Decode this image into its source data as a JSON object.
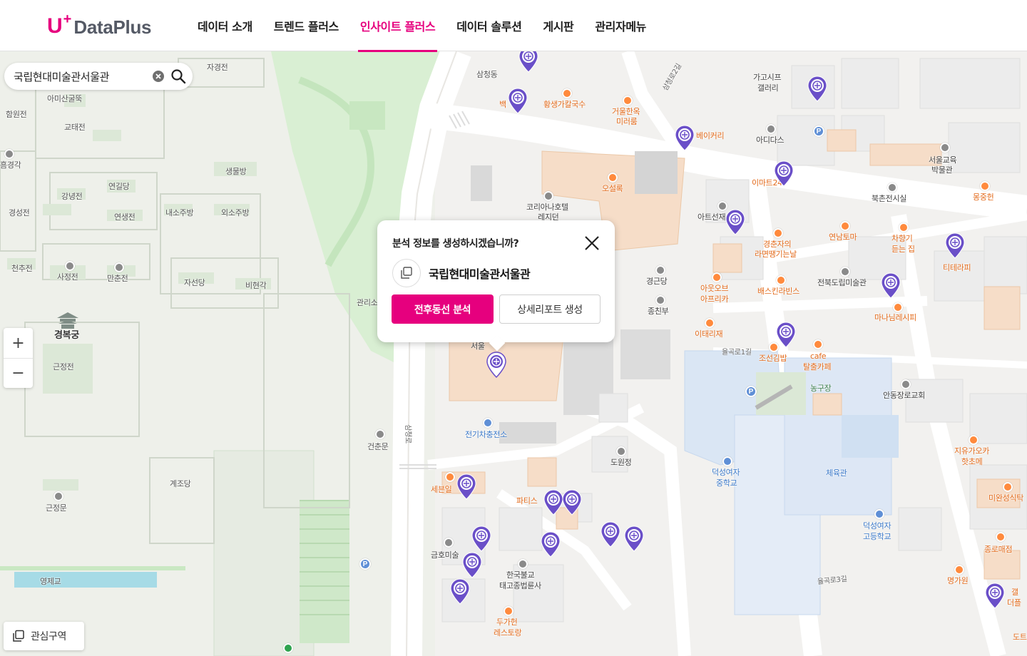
{
  "header": {
    "logo": {
      "mark": "U",
      "plus": "+",
      "text": "DataPlus"
    },
    "nav": [
      {
        "label": "데이터 소개",
        "active": false
      },
      {
        "label": "트렌드 플러스",
        "active": false
      },
      {
        "label": "인사이트 플러스",
        "active": true
      },
      {
        "label": "데이터 솔루션",
        "active": false
      },
      {
        "label": "게시판",
        "active": false
      },
      {
        "label": "관리자메뉴",
        "active": false
      }
    ]
  },
  "search": {
    "value": "국립현대미술관서울관",
    "clear_icon": "clear-icon",
    "search_icon": "search-icon"
  },
  "zoom": {
    "in": "+",
    "out": "−"
  },
  "interest_zone": {
    "label": "관심구역",
    "icon": "interest-zone-icon"
  },
  "popup": {
    "title": "분석 정보를 생성하시겠습니까?",
    "place": "국립현대미술관서울관",
    "primary_button": "전후동선 분석",
    "secondary_button": "상세리포트 생성"
  },
  "map_labels": {
    "palace": "경복궁",
    "buildings": [
      "자경전",
      "아미산굴뚝",
      "함원전",
      "교태전",
      "흠경각",
      "생물방",
      "연길당",
      "강녕전",
      "경성전",
      "연생전",
      "내소주방",
      "외소주방",
      "천추전",
      "사정전",
      "만춘전",
      "자선당",
      "비현각",
      "근정전",
      "계조당",
      "근정문",
      "영제교",
      "건춘문",
      "관리소"
    ],
    "places": [
      "삼청동",
      "백",
      "황생가칼국수",
      "거울한옥",
      "미러룸",
      "베이커리",
      "가고시프",
      "갤러리",
      "아디다스",
      "이마트24",
      "서울교육",
      "박물관",
      "북촌전시실",
      "몽중헌",
      "코리아나호텔",
      "레지던",
      "오설록",
      "아트선재",
      "경춘자의",
      "라면땡기는날",
      "연남토마",
      "차향기",
      "듣는 집",
      "티테라피",
      "경근당",
      "종친부",
      "아웃오브",
      "아프리카",
      "배스킨라빈스",
      "전북도립미술관",
      "마나님레시피",
      "이태리재",
      "조선김밥",
      "cafe",
      "탈출카페",
      "농구장",
      "안동장로교회",
      "서울",
      "전기차충전소",
      "도원정",
      "덕성여자",
      "중학교",
      "체육관",
      "지유가오카",
      "핫초메",
      "세븐일",
      "파티스",
      "금호미술",
      "한국불교",
      "태고종법륜사",
      "두가헌",
      "레스토랑",
      "덕성여자",
      "고등학교",
      "미완성식탁",
      "종로매점",
      "명가원",
      "갤",
      "더플",
      "도트"
    ],
    "roads": [
      "삼청로2길",
      "삼청로",
      "율곡로1길",
      "율곡로3길"
    ]
  }
}
